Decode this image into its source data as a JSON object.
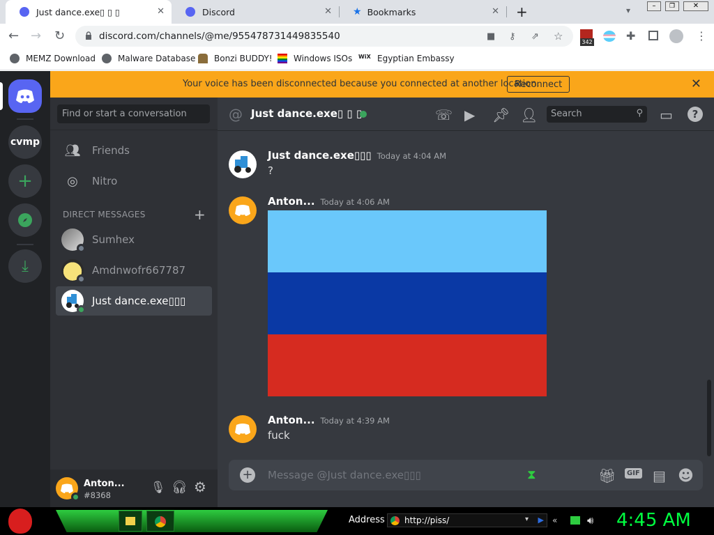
{
  "browser": {
    "tabs": [
      {
        "title": "Just dance.exe▯ ▯ ▯",
        "active": true
      },
      {
        "title": "Discord",
        "active": false
      },
      {
        "title": "Bookmarks",
        "active": false
      }
    ],
    "new_tab": "+",
    "url": "discord.com/channels/@me/955478731449835540",
    "badge_count": "342",
    "bookmarks": [
      "MEMZ Download",
      "Malware Database",
      "Bonzi BUDDY!",
      "Windows ISOs",
      "Egyptian Embassy"
    ]
  },
  "discord": {
    "banner": {
      "message": "Your voice has been disconnected because you connected at another location.",
      "reconnect_label": "Reconnect"
    },
    "servers": {
      "cvmp": "cvmp"
    },
    "dm_search_placeholder": "Find or start a conversation",
    "nav": {
      "friends": "Friends",
      "nitro": "Nitro"
    },
    "dm_header": "DIRECT MESSAGES",
    "dms": [
      {
        "name": "Sumhex",
        "status_color": "#747f8d"
      },
      {
        "name": "Amdnwofr667787",
        "status_color": "#747f8d"
      },
      {
        "name": "Just dance.exe▯▯▯",
        "status_color": "#3ba55d",
        "selected": true
      }
    ],
    "user": {
      "name": "Anton...",
      "tag": "#8368"
    },
    "channel": {
      "name": "Just dance.exe▯ ▯ ▯",
      "search_placeholder": "Search"
    },
    "messages": [
      {
        "author": "Just dance.exe▯▯▯",
        "time": "Today at 4:04 AM",
        "text": "?"
      },
      {
        "author": "Anton...",
        "time": "Today at 4:06 AM",
        "text": ""
      },
      {
        "author": "Anton...",
        "time": "Today at 4:39 AM",
        "text": "fuck"
      }
    ],
    "flag_colors": [
      "#6ac8fb",
      "#0a39a5",
      "#d62b20"
    ],
    "composer_placeholder": "Message @Just dance.exe▯▯▯",
    "gif_label": "GIF"
  },
  "taskbar": {
    "address_label": "Address",
    "address_value": "http://piss/",
    "clock": "4:45 AM"
  }
}
